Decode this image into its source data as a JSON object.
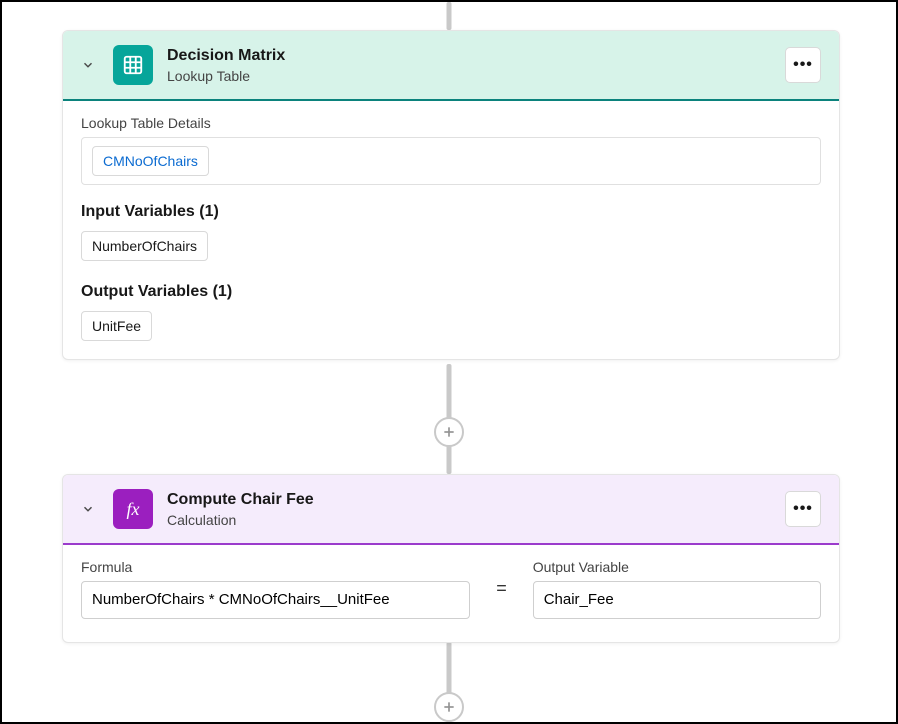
{
  "decision_matrix": {
    "title": "Decision Matrix",
    "subtitle": "Lookup Table",
    "details_label": "Lookup Table Details",
    "details_value": "CMNoOfChairs",
    "input_section": "Input Variables (1)",
    "input_var": "NumberOfChairs",
    "output_section": "Output Variables (1)",
    "output_var": "UnitFee"
  },
  "calculation": {
    "title": "Compute Chair Fee",
    "subtitle": "Calculation",
    "formula_label": "Formula",
    "formula_value": "NumberOfChairs * CMNoOfChairs__UnitFee",
    "equals": "=",
    "output_label": "Output Variable",
    "output_value": "Chair_Fee"
  },
  "symbols": {
    "more": "•••"
  }
}
